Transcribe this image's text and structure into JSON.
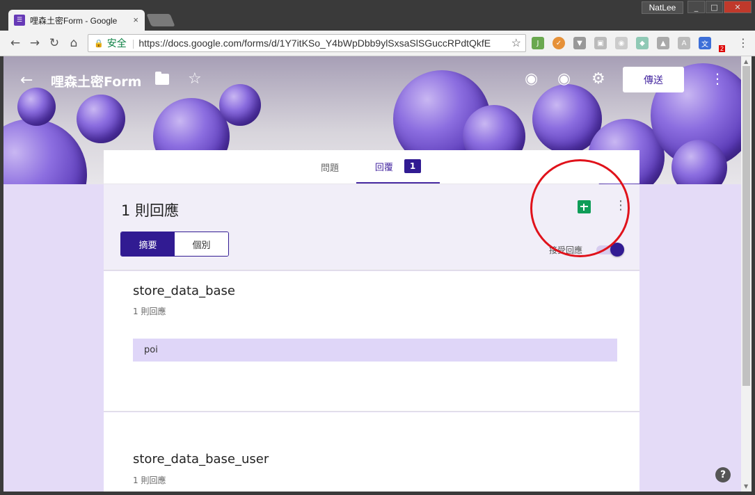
{
  "browser": {
    "tab_title": "哩森土密Form - Google",
    "tab_close": "×",
    "user": "NatLee",
    "win_min": "_",
    "win_max": "□",
    "win_close": "✕",
    "nav_back": "←",
    "nav_forward": "→",
    "nav_reload": "↻",
    "nav_home": "⌂",
    "secure_label": "安全",
    "url": "https://docs.google.com/forms/d/1Y7itKSo_Y4bWpDbb9ylSxsaSlSGuccRPdtQkfE",
    "ext_badge": "2",
    "menu": "⋮",
    "icons": [
      "lock-icon",
      "star-icon",
      "extension-icon"
    ]
  },
  "header": {
    "back": "←",
    "title": "哩森土密Form",
    "star": "☆",
    "palette": "◉",
    "preview": "◉",
    "settings": "⚙",
    "send_label": "傳送",
    "more": "⋮"
  },
  "tabs": {
    "questions": "問題",
    "responses": "回覆",
    "response_count": "1"
  },
  "responses": {
    "summary_title": "1 則回應",
    "seg_summary": "摘要",
    "seg_individual": "個別",
    "more": "⋮",
    "accepting_label": "接受回應",
    "accepting": true
  },
  "questions": [
    {
      "title": "store_data_base",
      "count": "1 則回應",
      "answer": "poi"
    },
    {
      "title": "store_data_base_user",
      "count": "1 則回應"
    }
  ],
  "help": "?",
  "colors": {
    "accent": "#311b92",
    "page_bg": "#e4dbf7",
    "answer_bg": "#dfd6f8",
    "sheets_green": "#0f9d58",
    "annotation_red": "#e0121b"
  }
}
